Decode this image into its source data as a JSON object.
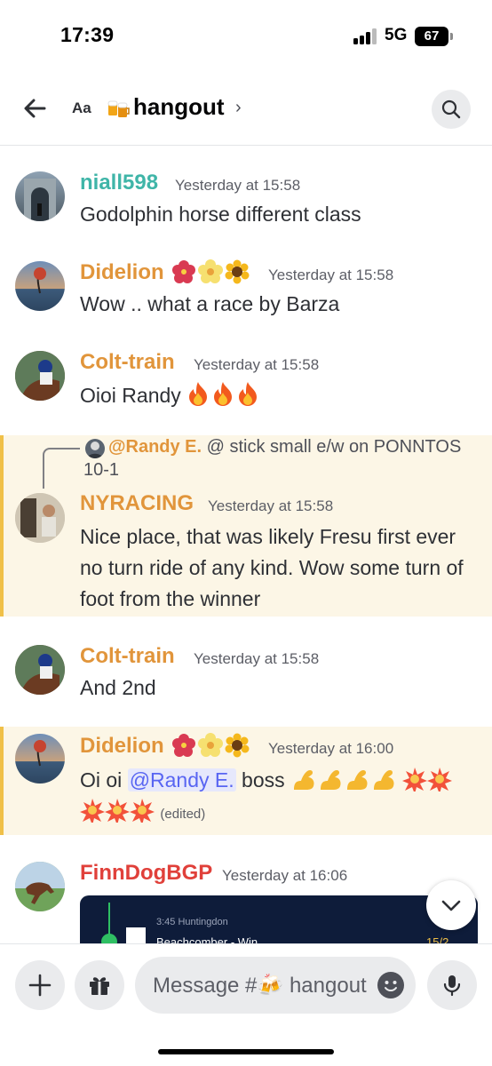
{
  "status_bar": {
    "time": "17:39",
    "network": "5G",
    "battery": "67"
  },
  "header": {
    "aa_label": "Aa",
    "channel_icon": "beer-mugs-emoji",
    "channel_name": "hangout",
    "chevron": "›"
  },
  "messages": [
    {
      "author": "niall598",
      "author_color": "#3fb5a8",
      "timestamp": "Yesterday at 15:58",
      "text": "Godolphin horse different class"
    },
    {
      "author": "Didelion",
      "author_color": "#e1953b",
      "badges": [
        "hibiscus-emoji",
        "blossom-emoji",
        "sunflower-emoji"
      ],
      "timestamp": "Yesterday at 15:58",
      "text": "Wow .. what a race by Barza"
    },
    {
      "author": "Colt-train",
      "author_color": "#e1953b",
      "timestamp": "Yesterday at 15:58",
      "text": "Oioi Randy",
      "trailing_emoji": [
        "fire-emoji",
        "fire-emoji",
        "fire-emoji"
      ]
    },
    {
      "reply_to": {
        "author": "@Randy E.",
        "text": " @ stick small e/w on PONNTOS 10-1"
      },
      "author": "NYRACING",
      "author_color": "#e1953b",
      "timestamp": "Yesterday at 15:58",
      "text": "Nice place, that was likely Fresu first ever no turn ride of any kind. Wow some turn of foot from the winner",
      "highlighted": true
    },
    {
      "author": "Colt-train",
      "author_color": "#e1953b",
      "timestamp": "Yesterday at 15:58",
      "text": "And 2nd"
    },
    {
      "author": "Didelion",
      "author_color": "#e1953b",
      "badges": [
        "hibiscus-emoji",
        "blossom-emoji",
        "sunflower-emoji"
      ],
      "timestamp": "Yesterday at 16:00",
      "text_before": "Oi oi ",
      "mention": "@Randy E.",
      "text_after": " boss",
      "edited": "(edited)",
      "highlighted": true
    },
    {
      "author": "FinnDogBGP",
      "author_color": "#e0403a",
      "timestamp": "Yesterday at 16:06",
      "embed": {
        "race": "3:45 Huntingdon",
        "horse": "Beachcomber - Win",
        "odds": "15/2"
      }
    }
  ],
  "composer": {
    "placeholder": "Message #🍻 hangout"
  },
  "colors": {
    "accent": "#5865f2",
    "highlight_bg": "#fcf6e6",
    "highlight_bar": "#f0c048"
  }
}
